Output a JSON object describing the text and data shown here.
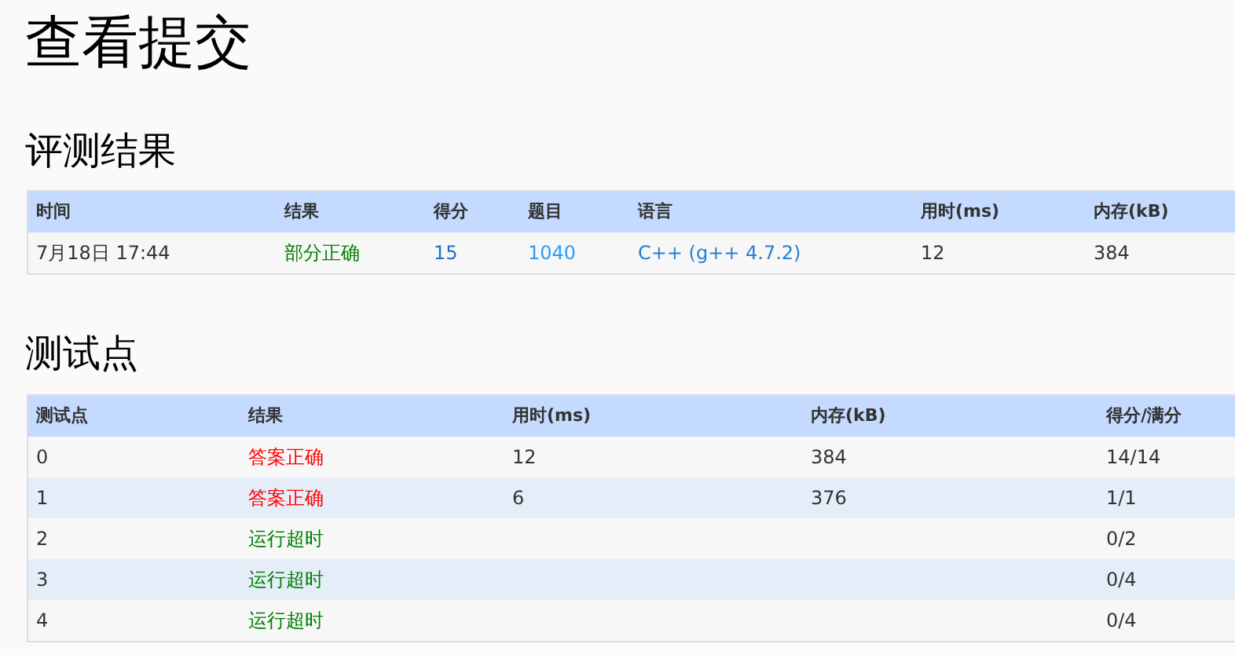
{
  "title": "查看提交",
  "judge": {
    "heading": "评测结果",
    "columns": [
      "时间",
      "结果",
      "得分",
      "题目",
      "语言",
      "用时(ms)",
      "内存(kB)"
    ],
    "row": {
      "time": "7月18日 17:44",
      "result": "部分正确",
      "color": "#008000",
      "score": "15",
      "problem": "1040",
      "language": "C++ (g++ 4.7.2)",
      "time_ms": "12",
      "memory": "384"
    }
  },
  "tests": {
    "heading": "测试点",
    "columns": [
      "测试点",
      "结果",
      "用时(ms)",
      "内存(kB)",
      "得分/满分"
    ],
    "rows": [
      {
        "id": "0",
        "result": "答案正确",
        "color": "#ff0000",
        "time_ms": "12",
        "memory": "384",
        "score": "14/14"
      },
      {
        "id": "1",
        "result": "答案正确",
        "color": "#ff0000",
        "time_ms": "6",
        "memory": "376",
        "score": "1/1"
      },
      {
        "id": "2",
        "result": "运行超时",
        "color": "#008000",
        "time_ms": "",
        "memory": "",
        "score": "0/2"
      },
      {
        "id": "3",
        "result": "运行超时",
        "color": "#008000",
        "time_ms": "",
        "memory": "",
        "score": "0/4"
      },
      {
        "id": "4",
        "result": "运行超时",
        "color": "#008000",
        "time_ms": "",
        "memory": "",
        "score": "0/4"
      }
    ]
  }
}
